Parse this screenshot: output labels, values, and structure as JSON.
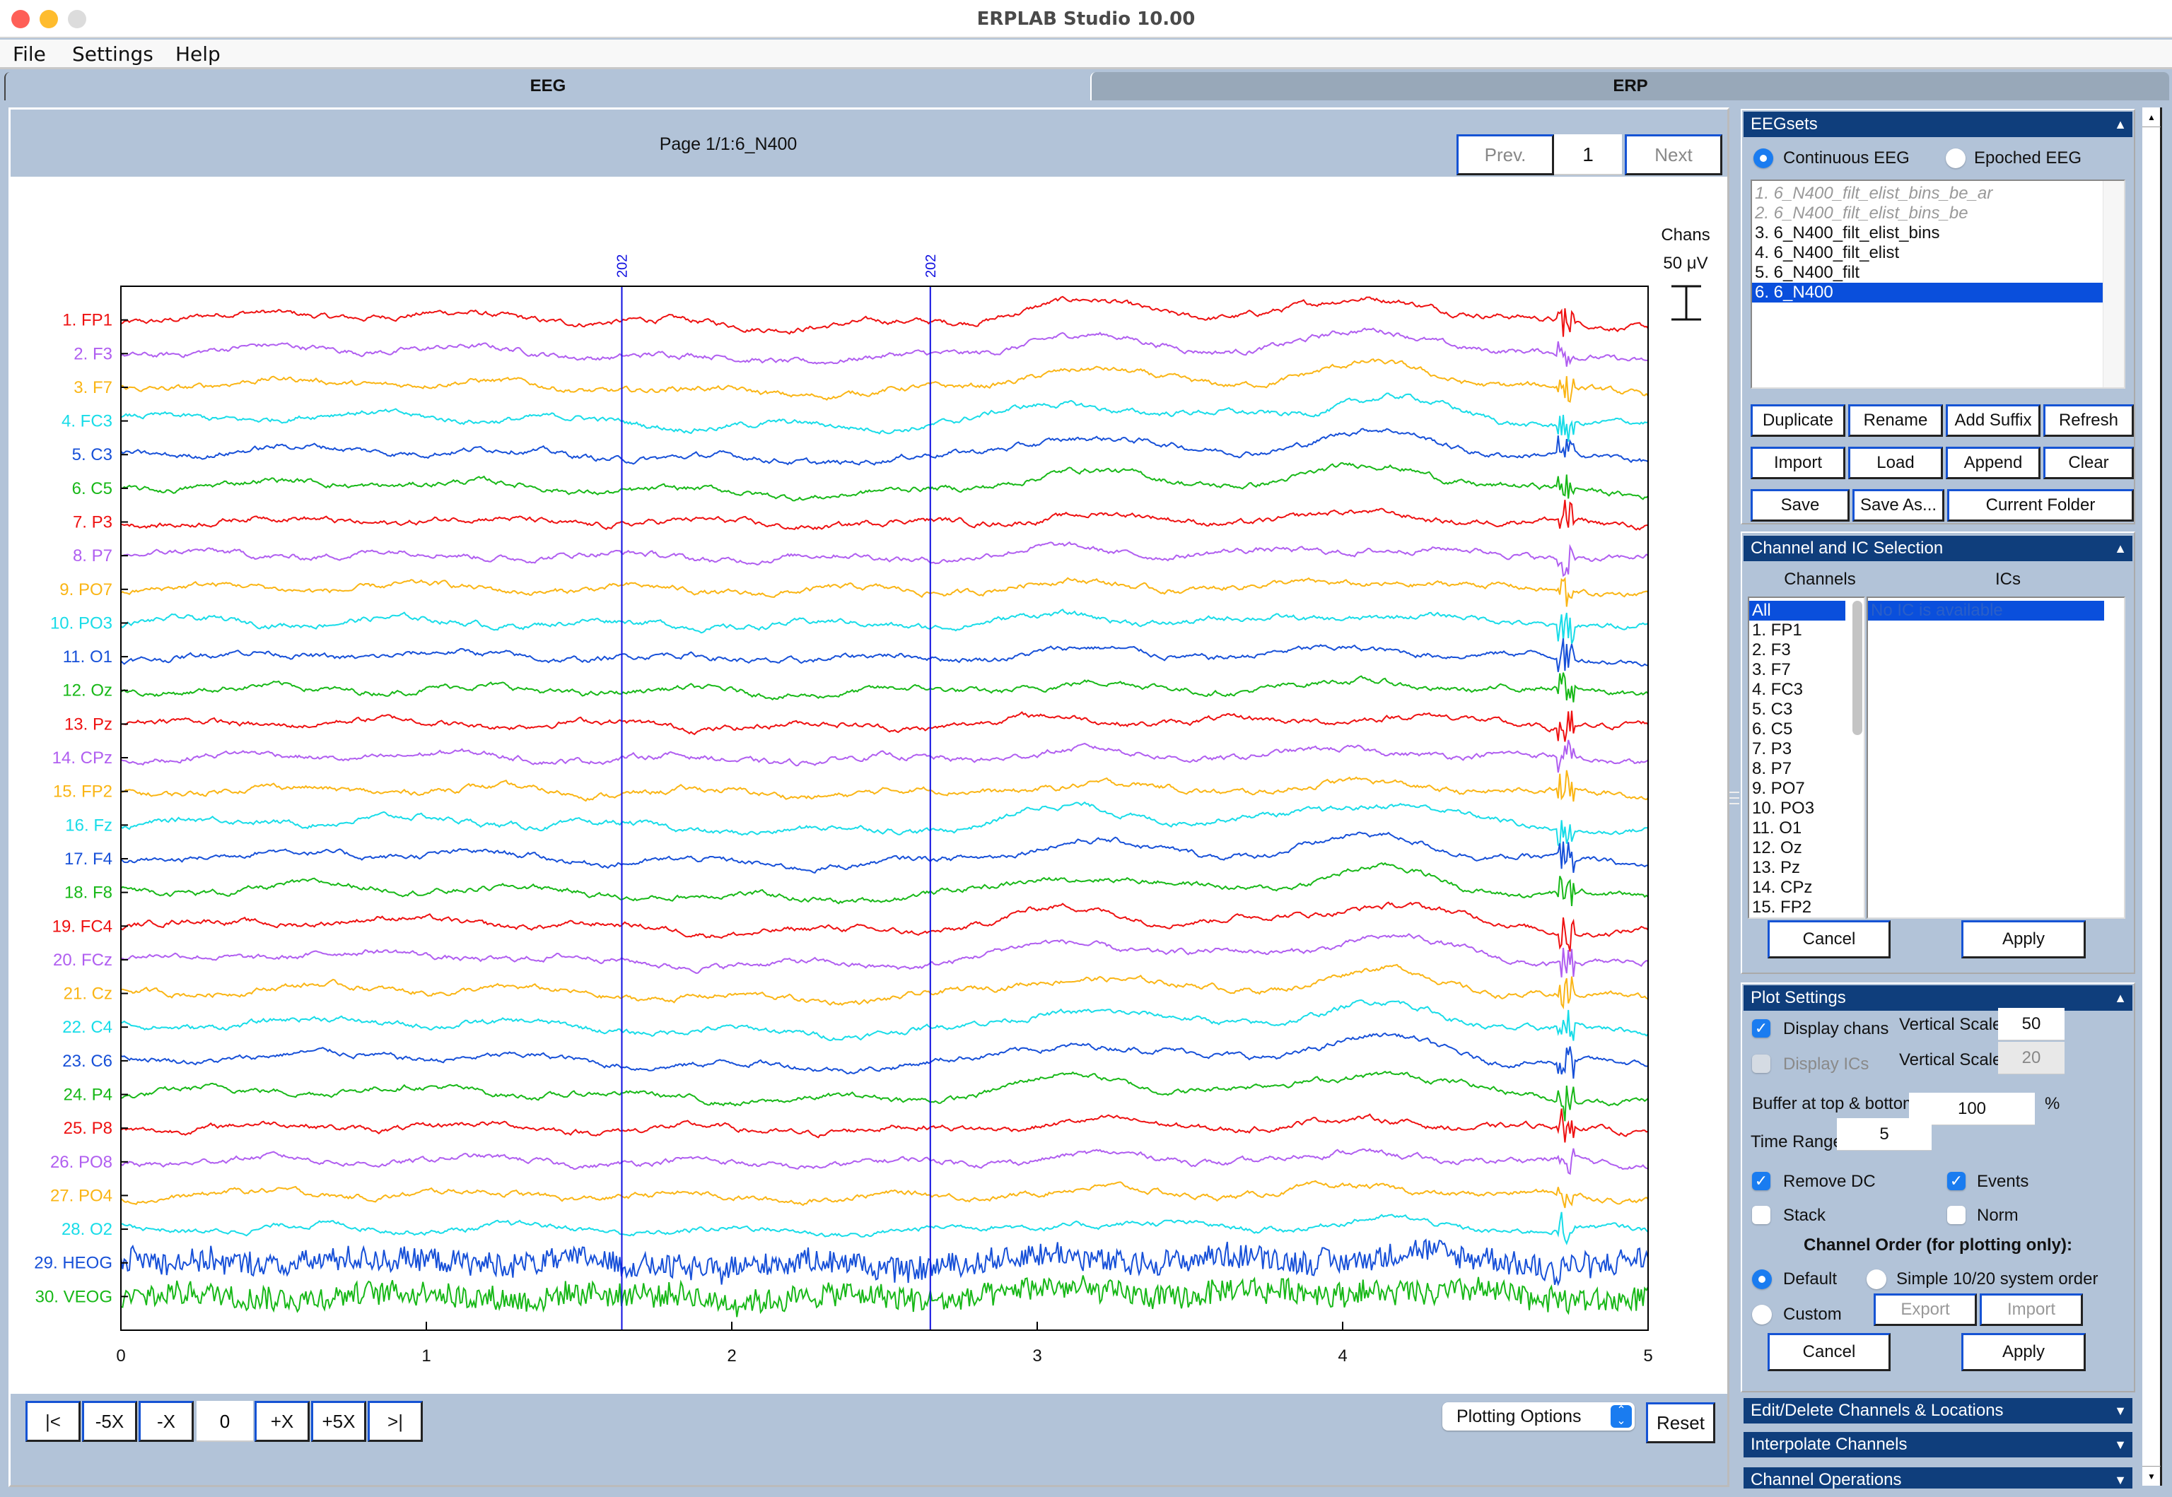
{
  "window": {
    "title": "ERPLAB Studio 10.00"
  },
  "menu": [
    "File",
    "Settings",
    "Help"
  ],
  "tabs": [
    {
      "label": "EEG",
      "active": true
    },
    {
      "label": "ERP",
      "active": false
    }
  ],
  "viewer": {
    "page_title": "Page 1/1:6_N400",
    "prev_label": "Prev.",
    "next_label": "Next",
    "page_number": "1",
    "scale_label_chans": "Chans",
    "scale_label_value": "50 μV",
    "toolbar": {
      "first_label": "|<",
      "minus5x_label": "-5X",
      "minusx_label": "-X",
      "shift_value": "0",
      "plusx_label": "+X",
      "plus5x_label": "+5X",
      "last_label": ">|",
      "plotting_options_label": "Plotting Options",
      "reset_label": "Reset"
    }
  },
  "chart_data": {
    "type": "line",
    "title": "",
    "xlabel": "",
    "ylabel": "",
    "xlim": [
      0,
      5
    ],
    "x_ticks": [
      "0",
      "1",
      "2",
      "3",
      "4",
      "5"
    ],
    "vertical_scale_uV": 50,
    "events": [
      {
        "time": 1.64,
        "label": "202"
      },
      {
        "time": 2.65,
        "label": "202"
      }
    ],
    "event_color": "#1010e0",
    "series": [
      {
        "name": "1. FP1",
        "color": "#ee1111"
      },
      {
        "name": "2. F3",
        "color": "#b05ef0"
      },
      {
        "name": "3. F7",
        "color": "#fab515"
      },
      {
        "name": "4. FC3",
        "color": "#18dce8"
      },
      {
        "name": "5. C3",
        "color": "#1750d8"
      },
      {
        "name": "6. C5",
        "color": "#18b818"
      },
      {
        "name": "7. P3",
        "color": "#ee1111"
      },
      {
        "name": "8. P7",
        "color": "#b05ef0"
      },
      {
        "name": "9. PO7",
        "color": "#fab515"
      },
      {
        "name": "10. PO3",
        "color": "#18dce8"
      },
      {
        "name": "11. O1",
        "color": "#1750d8"
      },
      {
        "name": "12. Oz",
        "color": "#18b818"
      },
      {
        "name": "13. Pz",
        "color": "#ee1111"
      },
      {
        "name": "14. CPz",
        "color": "#b05ef0"
      },
      {
        "name": "15. FP2",
        "color": "#fab515"
      },
      {
        "name": "16. Fz",
        "color": "#18dce8"
      },
      {
        "name": "17. F4",
        "color": "#1750d8"
      },
      {
        "name": "18. F8",
        "color": "#18b818"
      },
      {
        "name": "19. FC4",
        "color": "#ee1111"
      },
      {
        "name": "20. FCz",
        "color": "#b05ef0"
      },
      {
        "name": "21. Cz",
        "color": "#fab515"
      },
      {
        "name": "22. C4",
        "color": "#18dce8"
      },
      {
        "name": "23. C6",
        "color": "#1750d8"
      },
      {
        "name": "24. P4",
        "color": "#18b818"
      },
      {
        "name": "25. P8",
        "color": "#ee1111"
      },
      {
        "name": "26. PO8",
        "color": "#b05ef0"
      },
      {
        "name": "27. PO4",
        "color": "#fab515"
      },
      {
        "name": "28. O2",
        "color": "#18dce8"
      },
      {
        "name": "29. HEOG",
        "color": "#1750d8"
      },
      {
        "name": "30. VEOG",
        "color": "#18b818"
      }
    ]
  },
  "eegsets": {
    "header": "EEGsets",
    "radio_continuous": "Continuous EEG",
    "radio_epoched": "Epoched EEG",
    "selected_mode": "continuous",
    "items": [
      {
        "label": "1. 6_N400_filt_elist_bins_be_ar",
        "state": "dim"
      },
      {
        "label": "2. 6_N400_filt_elist_bins_be",
        "state": "dim"
      },
      {
        "label": "3. 6_N400_filt_elist_bins",
        "state": "normal"
      },
      {
        "label": "4. 6_N400_filt_elist",
        "state": "normal"
      },
      {
        "label": "5. 6_N400_filt",
        "state": "normal"
      },
      {
        "label": "6. 6_N400",
        "state": "selected"
      }
    ],
    "buttons_row1": [
      "Duplicate",
      "Rename",
      "Add Suffix",
      "Refresh"
    ],
    "buttons_row2": [
      "Import",
      "Load",
      "Append",
      "Clear"
    ],
    "buttons_row3": [
      "Save",
      "Save As...",
      "Current Folder"
    ]
  },
  "channel_selection": {
    "header": "Channel  and IC Selection",
    "channels_title": "Channels",
    "ics_title": "ICs",
    "channels": [
      "All",
      "1. FP1",
      "2. F3",
      "3. F7",
      "4. FC3",
      "5. C3",
      "6. C5",
      "7. P3",
      "8. P7",
      "9. PO7",
      "10. PO3",
      "11. O1",
      "12. Oz",
      "13. Pz",
      "14. CPz",
      "15. FP2"
    ],
    "ics": [
      "No IC is available"
    ],
    "cancel_label": "Cancel",
    "apply_label": "Apply"
  },
  "plot_settings": {
    "header": "Plot Settings",
    "display_chans_label": "Display chans",
    "display_chans_checked": true,
    "display_ics_label": "Display ICs",
    "display_ics_checked": false,
    "vertical_scale_label": "Vertical Scale:",
    "vertical_scale_chans": "50",
    "vertical_scale_ics": "20",
    "buffer_label": "Buffer at top & bottom:",
    "buffer_value": "100",
    "buffer_unit": "%",
    "time_range_label": "Time Range:",
    "time_range_value": "5",
    "remove_dc_label": "Remove DC",
    "remove_dc_checked": true,
    "events_label": "Events",
    "events_checked": true,
    "stack_label": "Stack",
    "stack_checked": false,
    "norm_label": "Norm",
    "norm_checked": false,
    "channel_order_title": "Channel Order (for plotting only):",
    "order_default_label": "Default",
    "order_simple_label": "Simple 10/20 system order",
    "order_custom_label": "Custom",
    "selected_order": "default",
    "export_label": "Export",
    "import_label": "Import",
    "cancel_label": "Cancel",
    "apply_label": "Apply"
  },
  "collapsed_sections": [
    "Edit/Delete Channels & Locations",
    "Interpolate Channels",
    "Channel Operations"
  ]
}
